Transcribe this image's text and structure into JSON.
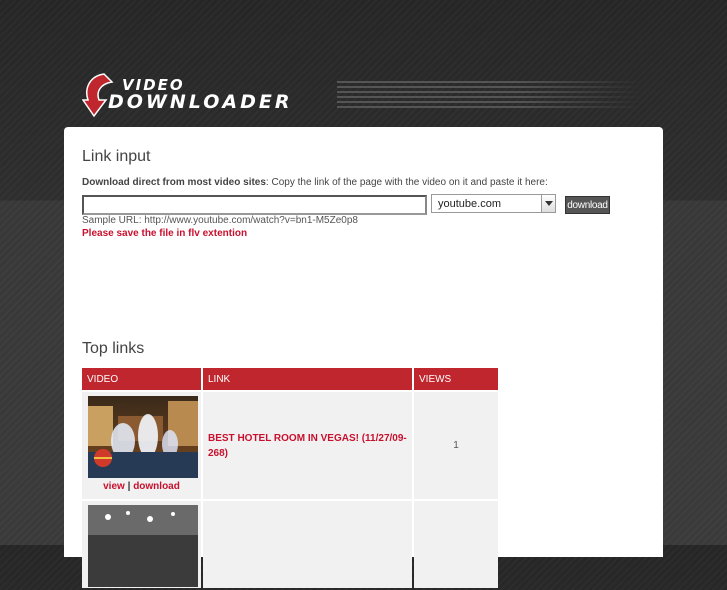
{
  "logo": {
    "line1": "VIDEO",
    "line2": "DOWNLOADER"
  },
  "link_input": {
    "heading": "Link input",
    "instruction_bold": "Download direct from most video sites",
    "instruction_rest": ": Copy the link of the page with the video on it and paste it here:",
    "url_value": "",
    "site_select": {
      "selected": "youtube.com"
    },
    "download_button": "download",
    "sample_url": "Sample URL: http://www.youtube.com/watch?v=bn1-M5Ze0p8",
    "warning": "Please save the file in flv extention"
  },
  "top_links": {
    "heading": "Top links",
    "columns": [
      "VIDEO",
      "LINK",
      "VIEWS"
    ],
    "rows": [
      {
        "view": "view",
        "separator": "|",
        "download": "download",
        "title": "BEST HOTEL ROOM IN VEGAS! (11/27/09-268)",
        "views": "1"
      },
      {
        "view": "",
        "separator": "",
        "download": "",
        "title": "",
        "views": ""
      }
    ]
  },
  "colors": {
    "accent": "#c0262d",
    "warning": "#c8102e",
    "background": "#2e2e2e"
  }
}
